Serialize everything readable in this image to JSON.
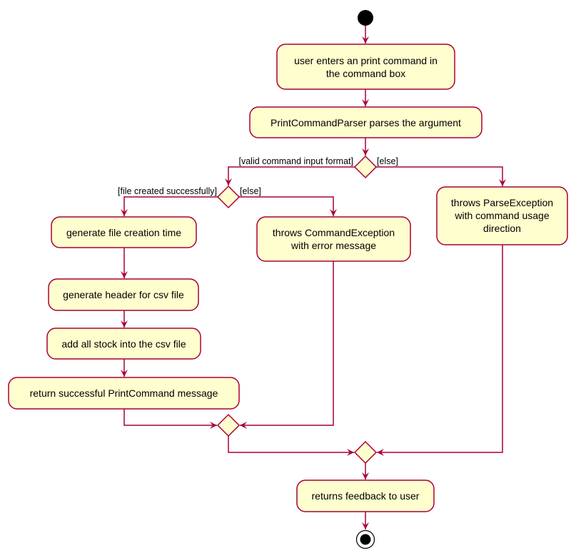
{
  "colors": {
    "fill": "#FEFECE",
    "border": "#A80036",
    "start": "#000000"
  },
  "activities": {
    "enter_command": [
      "user enters an print command in",
      "the command box"
    ],
    "parse": "PrintCommandParser parses the argument",
    "file_time": "generate file creation time",
    "header": "generate header for csv file",
    "add_stock": "add all stock into the csv file",
    "return_success": "return successful PrintCommand message",
    "command_exception": [
      "throws CommandException",
      "with error message"
    ],
    "parse_exception": [
      "throws ParseException",
      "with command usage",
      "direction"
    ],
    "feedback": "returns feedback to user"
  },
  "guards": {
    "valid": "[valid command input format]",
    "else1": "[else]",
    "file_ok": "[file created successfully]",
    "else2": "[else]"
  }
}
